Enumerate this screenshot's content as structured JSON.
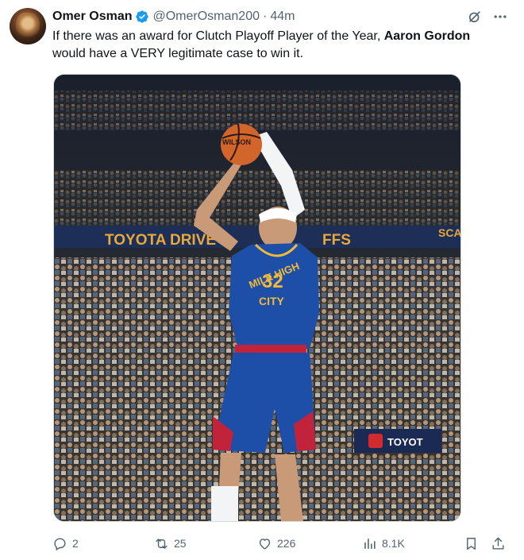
{
  "author": {
    "name": "Omer Osman",
    "handle": "@OmerOsman200",
    "separator": "·",
    "time": "44m",
    "avatar_icon": "profile-avatar",
    "verified_icon": "verified-badge-icon",
    "verified_color": "#1d9bf0"
  },
  "tweet": {
    "text_before": "If there was an award for Clutch Playoff Player of the Year, ",
    "text_bold": "Aaron Gordon",
    "text_after": " would have a VERY legitimate case to win it."
  },
  "media": {
    "banner_left": "TOYOTA DRIVE",
    "banner_mid": "FFS",
    "banner_right": "SCA",
    "sign_text": "TOYOT",
    "jersey_line1": "MILE HIGH",
    "jersey_number": "32",
    "jersey_line2": "CITY",
    "ball_text": "WILSON"
  },
  "actions": {
    "reply_count": "2",
    "retweet_count": "25",
    "like_count": "226",
    "views_count": "8.1K",
    "icons": [
      "reply-icon",
      "retweet-icon",
      "like-icon",
      "views-icon",
      "bookmark-icon",
      "share-icon"
    ]
  },
  "colors": {
    "text_primary": "#0f1419",
    "text_secondary": "#536471",
    "jersey_blue": "#1d4fa8",
    "jersey_yellow": "#f2b93b",
    "jersey_red": "#c1243a"
  }
}
